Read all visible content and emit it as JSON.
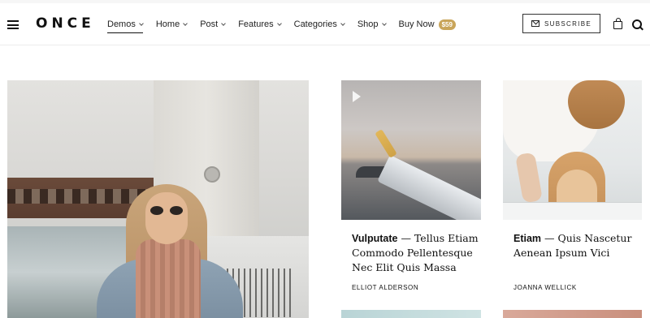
{
  "header": {
    "logo": "ONCE",
    "nav": [
      {
        "label": "Demos",
        "active": true,
        "dropdown": true
      },
      {
        "label": "Home",
        "dropdown": true
      },
      {
        "label": "Post",
        "dropdown": true
      },
      {
        "label": "Features",
        "dropdown": true
      },
      {
        "label": "Categories",
        "dropdown": true
      },
      {
        "label": "Shop",
        "dropdown": true
      },
      {
        "label": "Buy Now",
        "badge": "$59",
        "dropdown": false
      }
    ],
    "subscribe_label": "SUBSCRIBE",
    "icons": {
      "menu": "hamburger-icon",
      "subscribe": "mail-icon",
      "cart": "shopping-bag-icon",
      "search": "search-icon"
    },
    "badge_color": "#c9a55a"
  },
  "posts": [
    {
      "image": "woman-in-city",
      "title": "",
      "author": ""
    },
    {
      "image": "airplane-wing",
      "has_video": true,
      "title_bold": "Vulputate",
      "title_rest": " — Tellus Etiam Commodo Pellentesque Nec Elit Quis Massa",
      "author": "ELLIOT ALDERSON"
    },
    {
      "image": "woman-washing-dog",
      "title_bold": "Etiam",
      "title_rest": " — Quis Nascetur Aenean Ipsum Vici",
      "author": "JOANNA WELLICK"
    }
  ]
}
